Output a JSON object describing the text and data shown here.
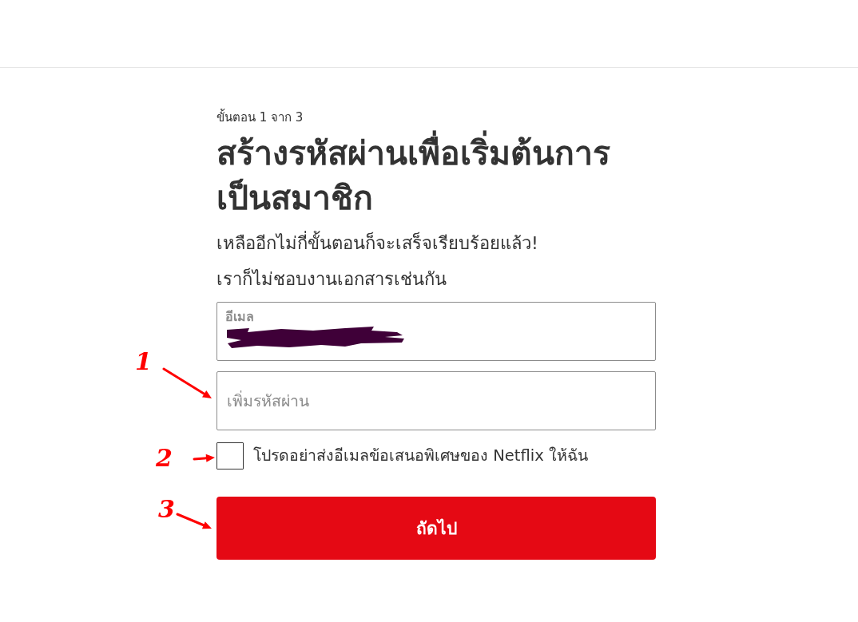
{
  "step": "ขั้นตอน 1 จาก 3",
  "title": "สร้างรหัสผ่านเพื่อเริ่มต้นการเป็นสมาชิก",
  "subtitle_lines": [
    "เหลืออีกไม่กี่ขั้นตอนก็จะเสร็จเรียบร้อยแล้ว!",
    "เราก็ไม่ชอบงานเอกสารเช่นกัน"
  ],
  "email_field": {
    "label": "อีเมล"
  },
  "password_field": {
    "placeholder": "เพิ่มรหัสผ่าน",
    "annotation": "1"
  },
  "offers_checkbox": {
    "label": "โปรดอย่าส่งอีเมลข้อเสนอพิเศษของ Netflix ให้ฉัน",
    "checked": false,
    "annotation": "2"
  },
  "next_button": {
    "label": "ถัดไป",
    "annotation": "3"
  }
}
